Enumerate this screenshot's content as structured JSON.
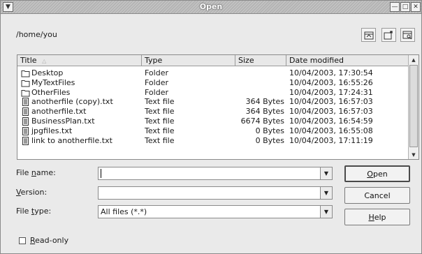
{
  "window": {
    "title": "Open",
    "menu_icon": "window-menu-icon",
    "controls": [
      "minimize-icon",
      "maximize-icon",
      "close-icon"
    ]
  },
  "path": "/home/you",
  "toolbar_icons": [
    "up-folder-icon",
    "new-folder-icon",
    "detail-view-icon"
  ],
  "columns": {
    "title": "Title",
    "type": "Type",
    "size": "Size",
    "date": "Date modified"
  },
  "files": [
    {
      "name": "Desktop",
      "type": "Folder",
      "size": "",
      "date": "10/04/2003, 17:30:54",
      "icon": "folder"
    },
    {
      "name": "MyTextFiles",
      "type": "Folder",
      "size": "",
      "date": "10/04/2003, 16:55:26",
      "icon": "folder"
    },
    {
      "name": "OtherFiles",
      "type": "Folder",
      "size": "",
      "date": "10/04/2003, 17:24:31",
      "icon": "folder"
    },
    {
      "name": "anotherfile (copy).txt",
      "type": "Text file",
      "size": "364 Bytes",
      "date": "10/04/2003, 16:57:03",
      "icon": "text-file"
    },
    {
      "name": "anotherfile.txt",
      "type": "Text file",
      "size": "364 Bytes",
      "date": "10/04/2003, 16:57:03",
      "icon": "text-file"
    },
    {
      "name": "BusinessPlan.txt",
      "type": "Text file",
      "size": "6674 Bytes",
      "date": "10/04/2003, 16:54:59",
      "icon": "text-file"
    },
    {
      "name": "jpgfiles.txt",
      "type": "Text file",
      "size": "0 Bytes",
      "date": "10/04/2003, 16:55:08",
      "icon": "text-file"
    },
    {
      "name": "link to anotherfile.txt",
      "type": "Text file",
      "size": "0 Bytes",
      "date": "10/04/2003, 17:11:19",
      "icon": "text-file"
    }
  ],
  "form": {
    "file_name_label_pre": "File ",
    "file_name_label_key": "n",
    "file_name_label_post": "ame:",
    "file_name_value": "",
    "version_label_key": "V",
    "version_label_post": "ersion:",
    "version_value": "",
    "file_type_label_pre": "File ",
    "file_type_label_key": "t",
    "file_type_label_post": "ype:",
    "file_type_value": "All files (*.*)"
  },
  "buttons": {
    "open_key": "O",
    "open_post": "pen",
    "cancel": "Cancel",
    "help_key": "H",
    "help_post": "elp"
  },
  "readonly": {
    "key": "R",
    "post": "ead-only",
    "checked": false
  }
}
